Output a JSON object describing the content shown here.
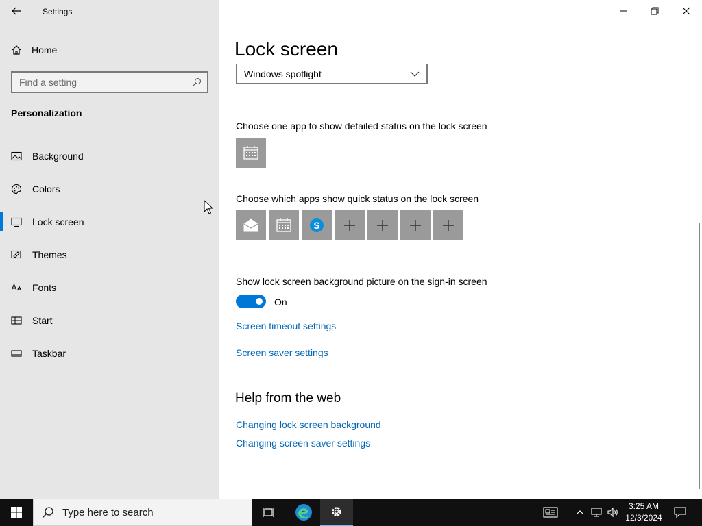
{
  "app": {
    "title": "Settings",
    "back_icon": "back-arrow-icon"
  },
  "window_controls": {
    "minimize_icon": "minimize-icon",
    "restore_icon": "restore-icon",
    "close_icon": "close-icon"
  },
  "sidebar": {
    "home_label": "Home",
    "search_placeholder": "Find a setting",
    "section_title": "Personalization",
    "items": [
      {
        "label": "Background",
        "icon": "picture-icon",
        "active": false
      },
      {
        "label": "Colors",
        "icon": "palette-icon",
        "active": false
      },
      {
        "label": "Lock screen",
        "icon": "lock-screen-icon",
        "active": true
      },
      {
        "label": "Themes",
        "icon": "themes-icon",
        "active": false
      },
      {
        "label": "Fonts",
        "icon": "fonts-icon",
        "active": false
      },
      {
        "label": "Start",
        "icon": "start-icon",
        "active": false
      },
      {
        "label": "Taskbar",
        "icon": "taskbar-icon",
        "active": false
      }
    ]
  },
  "main": {
    "title": "Lock screen",
    "background_dropdown": "Windows spotlight",
    "detailed_status_label": "Choose one app to show detailed status on the lock screen",
    "detailed_status_app": "calendar-icon",
    "quick_status_label": "Choose which apps show quick status on the lock screen",
    "quick_status_apps": [
      "mail-icon",
      "calendar-icon",
      "skype-icon",
      "plus-icon",
      "plus-icon",
      "plus-icon",
      "plus-icon"
    ],
    "signin_bg_label": "Show lock screen background picture on the sign-in screen",
    "signin_bg_state": "On",
    "links": {
      "screen_timeout": "Screen timeout settings",
      "screen_saver": "Screen saver settings"
    },
    "help": {
      "title": "Help from the web",
      "links": [
        "Changing lock screen background",
        "Changing screen saver settings"
      ]
    }
  },
  "taskbar": {
    "search_placeholder": "Type here to search",
    "time": "3:25 AM",
    "date": "12/3/2024",
    "colors": {
      "accent": "#0078d7",
      "background": "#101010"
    }
  }
}
